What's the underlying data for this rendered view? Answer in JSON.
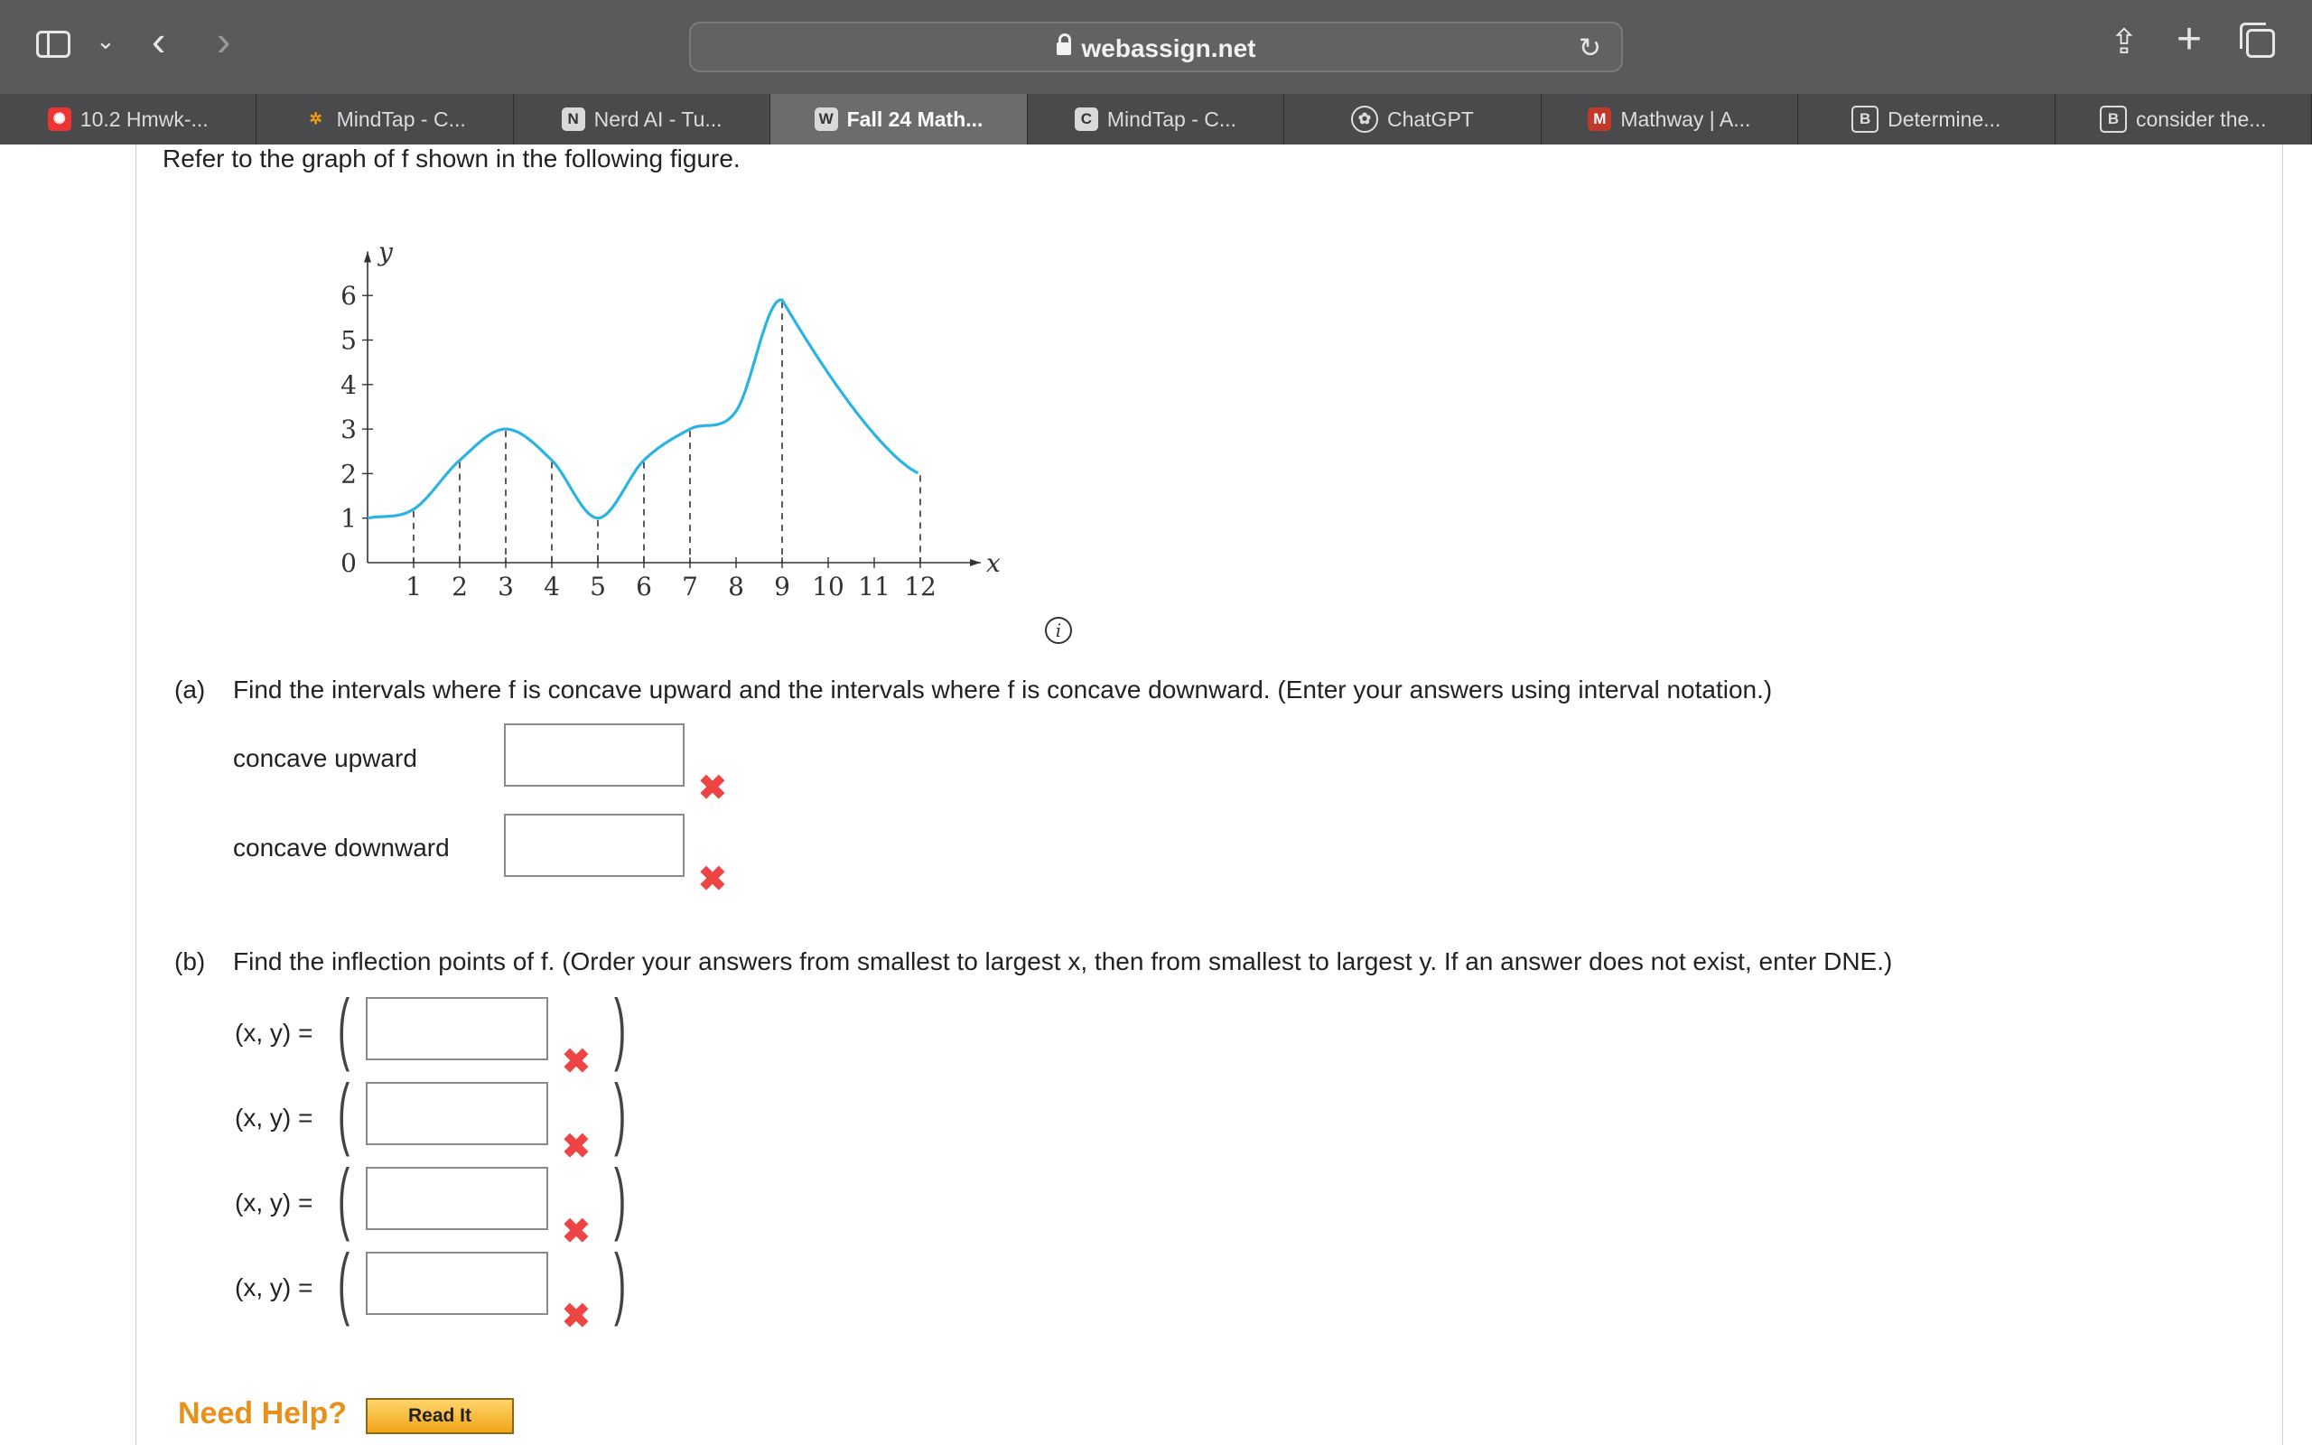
{
  "browser": {
    "url": "webassign.net",
    "tabs": [
      {
        "label": "10.2 Hmwk-...",
        "icon": "webassign-logo-icon",
        "active": false
      },
      {
        "label": "MindTap - C...",
        "icon": "mindtap-logo-icon",
        "active": false
      },
      {
        "label": "Nerd AI - Tu...",
        "icon": "N",
        "active": false
      },
      {
        "label": "Fall 24 Math...",
        "icon": "W",
        "active": true
      },
      {
        "label": "MindTap - C...",
        "icon": "C",
        "active": false
      },
      {
        "label": "ChatGPT",
        "icon": "chatgpt-logo-icon",
        "active": false
      },
      {
        "label": "Mathway | A...",
        "icon": "M",
        "active": false
      },
      {
        "label": "Determine...",
        "icon": "B",
        "active": false
      },
      {
        "label": "consider the...",
        "icon": "B",
        "active": false
      }
    ]
  },
  "problem": {
    "intro": "Refer to the graph of f shown in the following figure.",
    "info_glyph": "i",
    "part_a": {
      "label": "(a)",
      "prompt": "Find the intervals where f is concave upward and the intervals where f is concave downward. (Enter your answers using interval notation.)",
      "fields": [
        {
          "label": "concave upward",
          "value": "",
          "status": "incorrect"
        },
        {
          "label": "concave downward",
          "value": "",
          "status": "incorrect"
        }
      ]
    },
    "part_b": {
      "label": "(b)",
      "prompt": "Find the inflection points of f. (Order your answers from smallest to largest x, then from smallest to largest y. If an answer does not exist, enter DNE.)",
      "rows": [
        {
          "label": "(x, y)  =",
          "value": "",
          "status": "incorrect"
        },
        {
          "label": "(x, y)  =",
          "value": "",
          "status": "incorrect"
        },
        {
          "label": "(x, y)  =",
          "value": "",
          "status": "incorrect"
        },
        {
          "label": "(x, y)  =",
          "value": "",
          "status": "incorrect"
        }
      ]
    },
    "need_help": "Need Help?",
    "read_it": "Read It",
    "mark_glyph": "✖"
  },
  "chart_data": {
    "type": "line",
    "xlabel": "x",
    "ylabel": "y",
    "x_ticks": [
      1,
      2,
      3,
      4,
      5,
      6,
      7,
      8,
      9,
      10,
      11,
      12
    ],
    "y_ticks": [
      0,
      1,
      2,
      3,
      4,
      5,
      6
    ],
    "xlim": [
      0,
      13
    ],
    "ylim": [
      0,
      6.5
    ],
    "series": [
      {
        "color": "#2bb3e3",
        "points": [
          [
            0,
            1
          ],
          [
            1,
            1.2
          ],
          [
            2,
            2.3
          ],
          [
            3,
            3
          ],
          [
            4,
            2.3
          ],
          [
            5,
            1
          ],
          [
            6,
            2.3
          ],
          [
            7,
            3
          ],
          [
            8,
            3.4
          ],
          [
            9,
            5.9
          ],
          [
            12,
            2
          ]
        ]
      }
    ],
    "dashed_x": [
      1,
      2,
      3,
      4,
      5,
      6,
      7,
      9,
      12
    ]
  }
}
